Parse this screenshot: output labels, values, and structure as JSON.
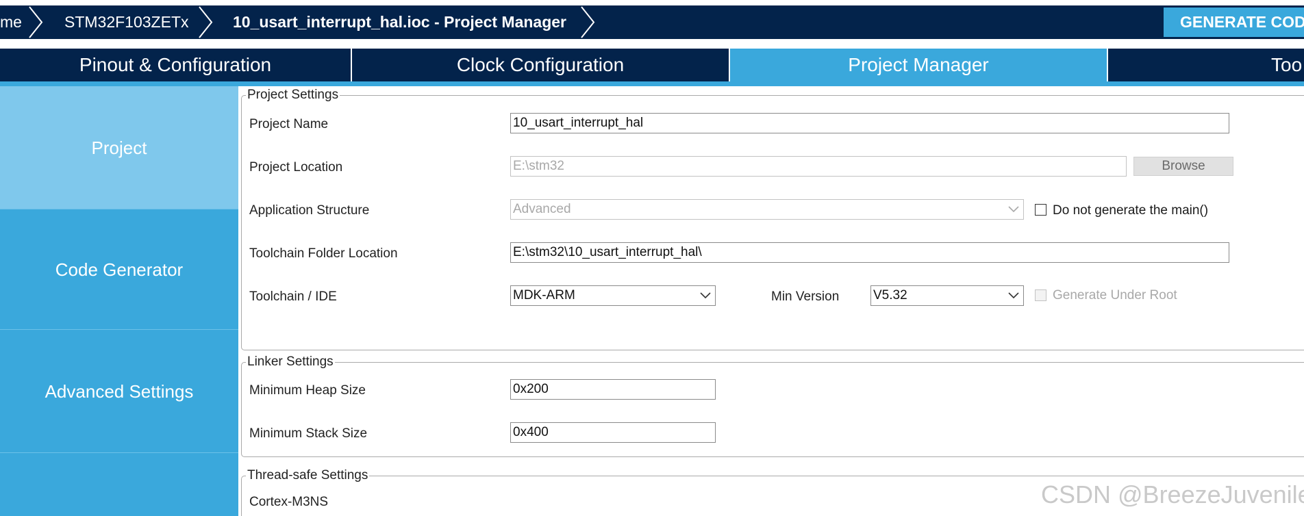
{
  "breadcrumb": {
    "home": "me",
    "mcu": "STM32F103ZETx",
    "current": "10_usart_interrupt_hal.ioc - Project Manager"
  },
  "toolbar": {
    "generate_code_label": "GENERATE COD"
  },
  "tabs": [
    {
      "label": "Pinout & Configuration",
      "active": false
    },
    {
      "label": "Clock Configuration",
      "active": false
    },
    {
      "label": "Project Manager",
      "active": true
    },
    {
      "label": "Too",
      "active": false
    }
  ],
  "sidebar": {
    "items": [
      {
        "label": "Project",
        "active": true
      },
      {
        "label": "Code Generator",
        "active": false
      },
      {
        "label": "Advanced Settings",
        "active": false
      },
      {
        "label": "",
        "active": false
      }
    ]
  },
  "project_settings": {
    "legend": "Project Settings",
    "project_name_label": "Project Name",
    "project_name_value": "10_usart_interrupt_hal",
    "project_location_label": "Project Location",
    "project_location_value": "E:\\stm32",
    "browse_label": "Browse",
    "app_structure_label": "Application Structure",
    "app_structure_value": "Advanced",
    "no_main_label": "Do not generate the main()",
    "no_main_checked": false,
    "toolchain_folder_label": "Toolchain Folder Location",
    "toolchain_folder_value": "E:\\stm32\\10_usart_interrupt_hal\\",
    "toolchain_ide_label": "Toolchain / IDE",
    "toolchain_ide_value": "MDK-ARM",
    "min_version_label": "Min Version",
    "min_version_value": "V5.32",
    "gen_under_root_label": "Generate Under Root",
    "gen_under_root_checked": false
  },
  "linker_settings": {
    "legend": "Linker Settings",
    "heap_label": "Minimum Heap Size",
    "heap_value": "0x200",
    "stack_label": "Minimum Stack Size",
    "stack_value": "0x400"
  },
  "thread_safe_settings": {
    "legend": "Thread-safe Settings",
    "core_label": "Cortex-M3NS"
  },
  "watermark": "CSDN @BreezeJuvenile",
  "colors": {
    "navy": "#03234b",
    "accent": "#3aa8dc",
    "sidebar_active": "#7fc8ec"
  }
}
